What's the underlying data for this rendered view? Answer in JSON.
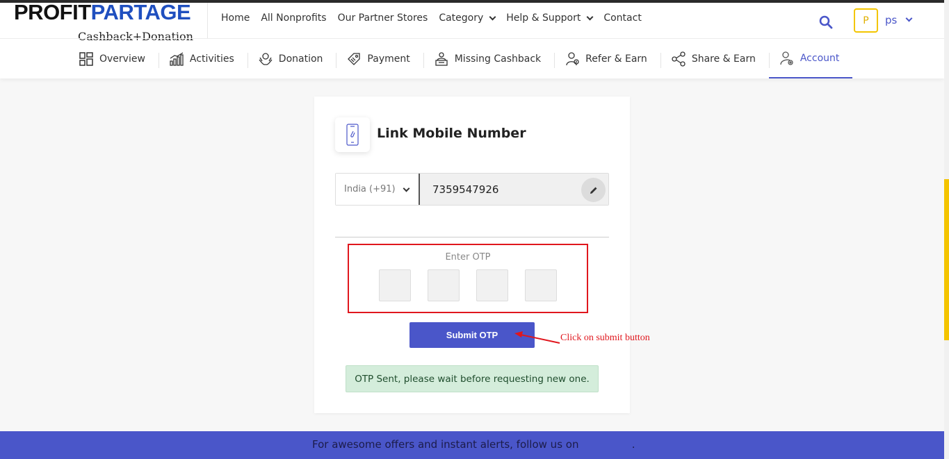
{
  "brand": {
    "name_part1": "PROFIT",
    "name_part2": "PARTAGE",
    "tagline": "Cashback+Donation",
    "accent_color": "#4a56c9",
    "logo_blue": "#1f4fbf"
  },
  "nav": {
    "items": [
      {
        "label": "Home"
      },
      {
        "label": "All Nonprofits"
      },
      {
        "label": "Our Partner Stores"
      },
      {
        "label": "Category",
        "dropdown": true
      },
      {
        "label": "Help & Support",
        "dropdown": true
      },
      {
        "label": "Contact"
      }
    ]
  },
  "user": {
    "avatar_letter": "P",
    "name": "ps"
  },
  "tabs": [
    {
      "label": "Overview",
      "icon": "grid-icon"
    },
    {
      "label": "Activities",
      "icon": "bar-chart-icon"
    },
    {
      "label": "Donation",
      "icon": "donation-hands-icon"
    },
    {
      "label": "Payment",
      "icon": "tag-icon"
    },
    {
      "label": "Missing Cashback",
      "icon": "person-desk-icon"
    },
    {
      "label": "Refer & Earn",
      "icon": "refer-person-icon"
    },
    {
      "label": "Share & Earn",
      "icon": "share-icon"
    },
    {
      "label": "Account",
      "icon": "account-gear-icon",
      "active": true
    }
  ],
  "card": {
    "title": "Link Mobile Number",
    "country": "India (+91)",
    "phone": "7359547926",
    "otp_label": "Enter OTP",
    "submit_label": "Submit OTP",
    "alert_message": "OTP Sent, please wait before requesting new one."
  },
  "annotation": {
    "text": "Click on submit button",
    "color": "#e0161d"
  },
  "footer": {
    "text": "For awesome offers and instant alerts, follow us on                ."
  }
}
